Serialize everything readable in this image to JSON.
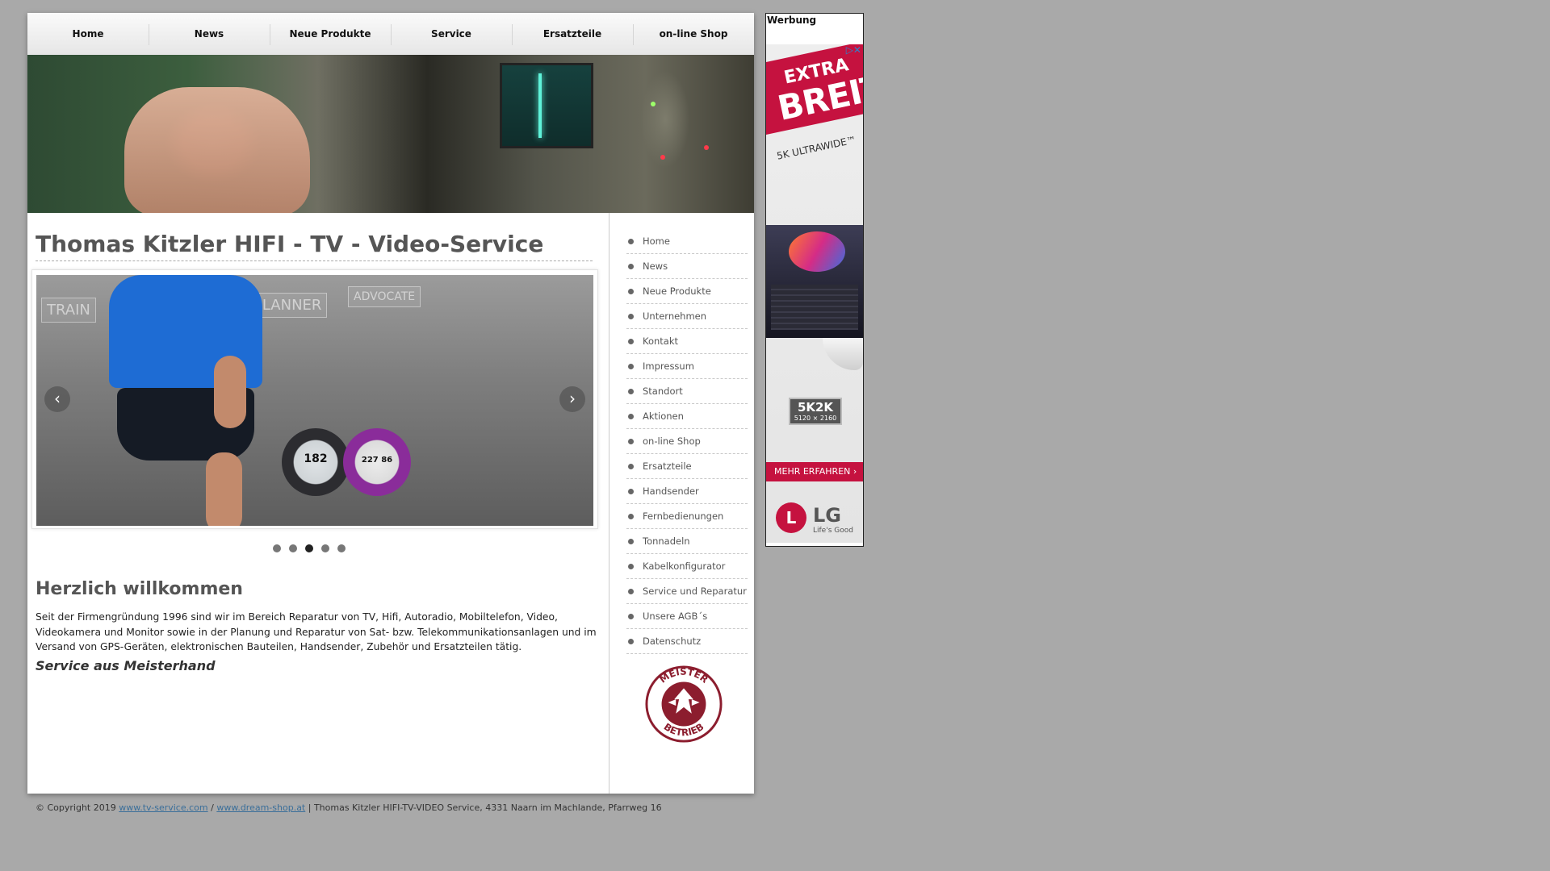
{
  "nav": [
    "Home",
    "News",
    "Neue Produkte",
    "Service",
    "Ersatzteile",
    "on-line Shop"
  ],
  "page_title": "Thomas Kitzler HIFI - TV - Video-Service",
  "slider": {
    "panels": [
      "TRAIN",
      "PLANNER",
      "ADVOCATE"
    ],
    "watch_values": [
      "182",
      "227 86"
    ],
    "active_dot": 3,
    "dot_count": 5
  },
  "welcome": {
    "heading": "Herzlich willkommen",
    "body": "Seit der Firmengründung 1996 sind wir im Bereich Reparatur von TV, Hifi, Autoradio, Mobiltelefon, Video, Videokamera und Monitor sowie in der Planung und Reparatur von Sat- bzw. Telekommunikationsanlagen und im Versand von GPS-Geräten, elektronischen Bauteilen, Handsender, Zubehör und Ersatzteilen tätig.",
    "slogan": "Service aus Meisterhand"
  },
  "sidebar_menu": [
    "Home",
    "News",
    "Neue Produkte",
    "Unternehmen",
    "Kontakt",
    "Impressum",
    "Standort",
    "Aktionen",
    "on-line Shop",
    "Ersatzteile",
    "Handsender",
    "Fernbedienungen",
    "Tonnadeln",
    "Kabelkonfigurator",
    "Service und Reparatur",
    "Unsere AGB´s",
    "Datenschutz"
  ],
  "seal": {
    "top": "MEISTER",
    "bottom": "BETRIEB"
  },
  "footer": {
    "copyright": "© Copyright 2019",
    "link1": "www.tv-service.com",
    "sep": "/",
    "link2": "www.dream-shop.at",
    "rest": "| Thomas Kitzler HIFI-TV-VIDEO Service, 4331 Naarn im Machlande, Pfarrweg 16"
  },
  "ad": {
    "label": "Werbung",
    "line1": "EXTRA",
    "line2": "BREIT",
    "line3": "5K ULTRAWIDE™",
    "res_big": "5K2K",
    "res_small": "5120 × 2160",
    "cta": "MEHR ERFAHREN ›",
    "brand": "LG",
    "tagline": "Life's Good"
  },
  "colors": {
    "accent_red": "#c5123f",
    "link": "#3b6f9a",
    "background": "#a9a9a9"
  }
}
